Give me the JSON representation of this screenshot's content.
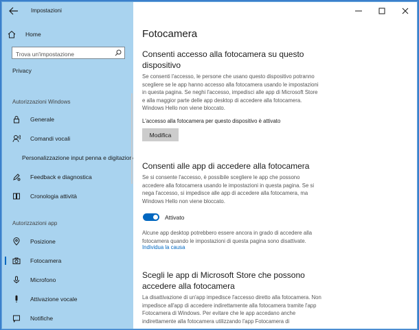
{
  "window": {
    "title": "Impostazioni"
  },
  "sidebar": {
    "home_label": "Home",
    "search_placeholder": "Trova un'impostazione",
    "section": "Privacy",
    "groups": [
      {
        "label": "Autorizzazioni Windows",
        "items": [
          "Generale",
          "Comandi vocali",
          "Personalizzazione input penna e digitazione",
          "Feedback e diagnostica",
          "Cronologia attività"
        ]
      },
      {
        "label": "Autorizzazioni app",
        "items": [
          "Posizione",
          "Fotocamera",
          "Microfono",
          "Attivazione vocale",
          "Notifiche"
        ]
      }
    ],
    "selected": "Fotocamera"
  },
  "main": {
    "title": "Fotocamera",
    "s1": {
      "heading": "Consenti accesso alla fotocamera su questo dispositivo",
      "body": "Se consenti l'accesso, le persone che usano questo dispositivo potranno scegliere se le app hanno accesso alla fotocamera usando le impostazioni in questa pagina. Se neghi l'accesso, impedisci alle app di Microsoft Store e alla maggior parte delle app desktop di accedere alla fotocamera. Windows Hello non viene bloccato.",
      "status": "L'accesso alla fotocamera per questo dispositivo è attivato",
      "button": "Modifica"
    },
    "s2": {
      "heading": "Consenti alle app di accedere alla fotocamera",
      "body": "Se si consente l'accesso, è possibile scegliere le app che possono accedere alla fotocamera usando le impostazioni in questa pagina. Se si nega l'accesso, si impedisce alle app di accedere alla fotocamera, ma Windows Hello non viene bloccato.",
      "toggle_label": "Attivato",
      "toggle_on": true,
      "note": "Alcune app desktop potrebbero essere ancora in grado di accedere alla fotocamera quando le impostazioni di questa pagina sono disattivate.",
      "link": "Individua la causa"
    },
    "s3": {
      "heading": "Scegli le app di Microsoft Store che possono accedere alla fotocamera",
      "body": "La disattivazione di un'app impedisce l'accesso diretto alla fotocamera. Non impedisce all'app di accedere indirettamente alla fotocamera tramite l'app Fotocamera di Windows. Per evitare che le app accedano anche indirettamente alla fotocamera utilizzando l'app Fotocamera di"
    }
  },
  "colors": {
    "accent": "#0067c0",
    "sidebar_bg": "#a9d3ef"
  }
}
